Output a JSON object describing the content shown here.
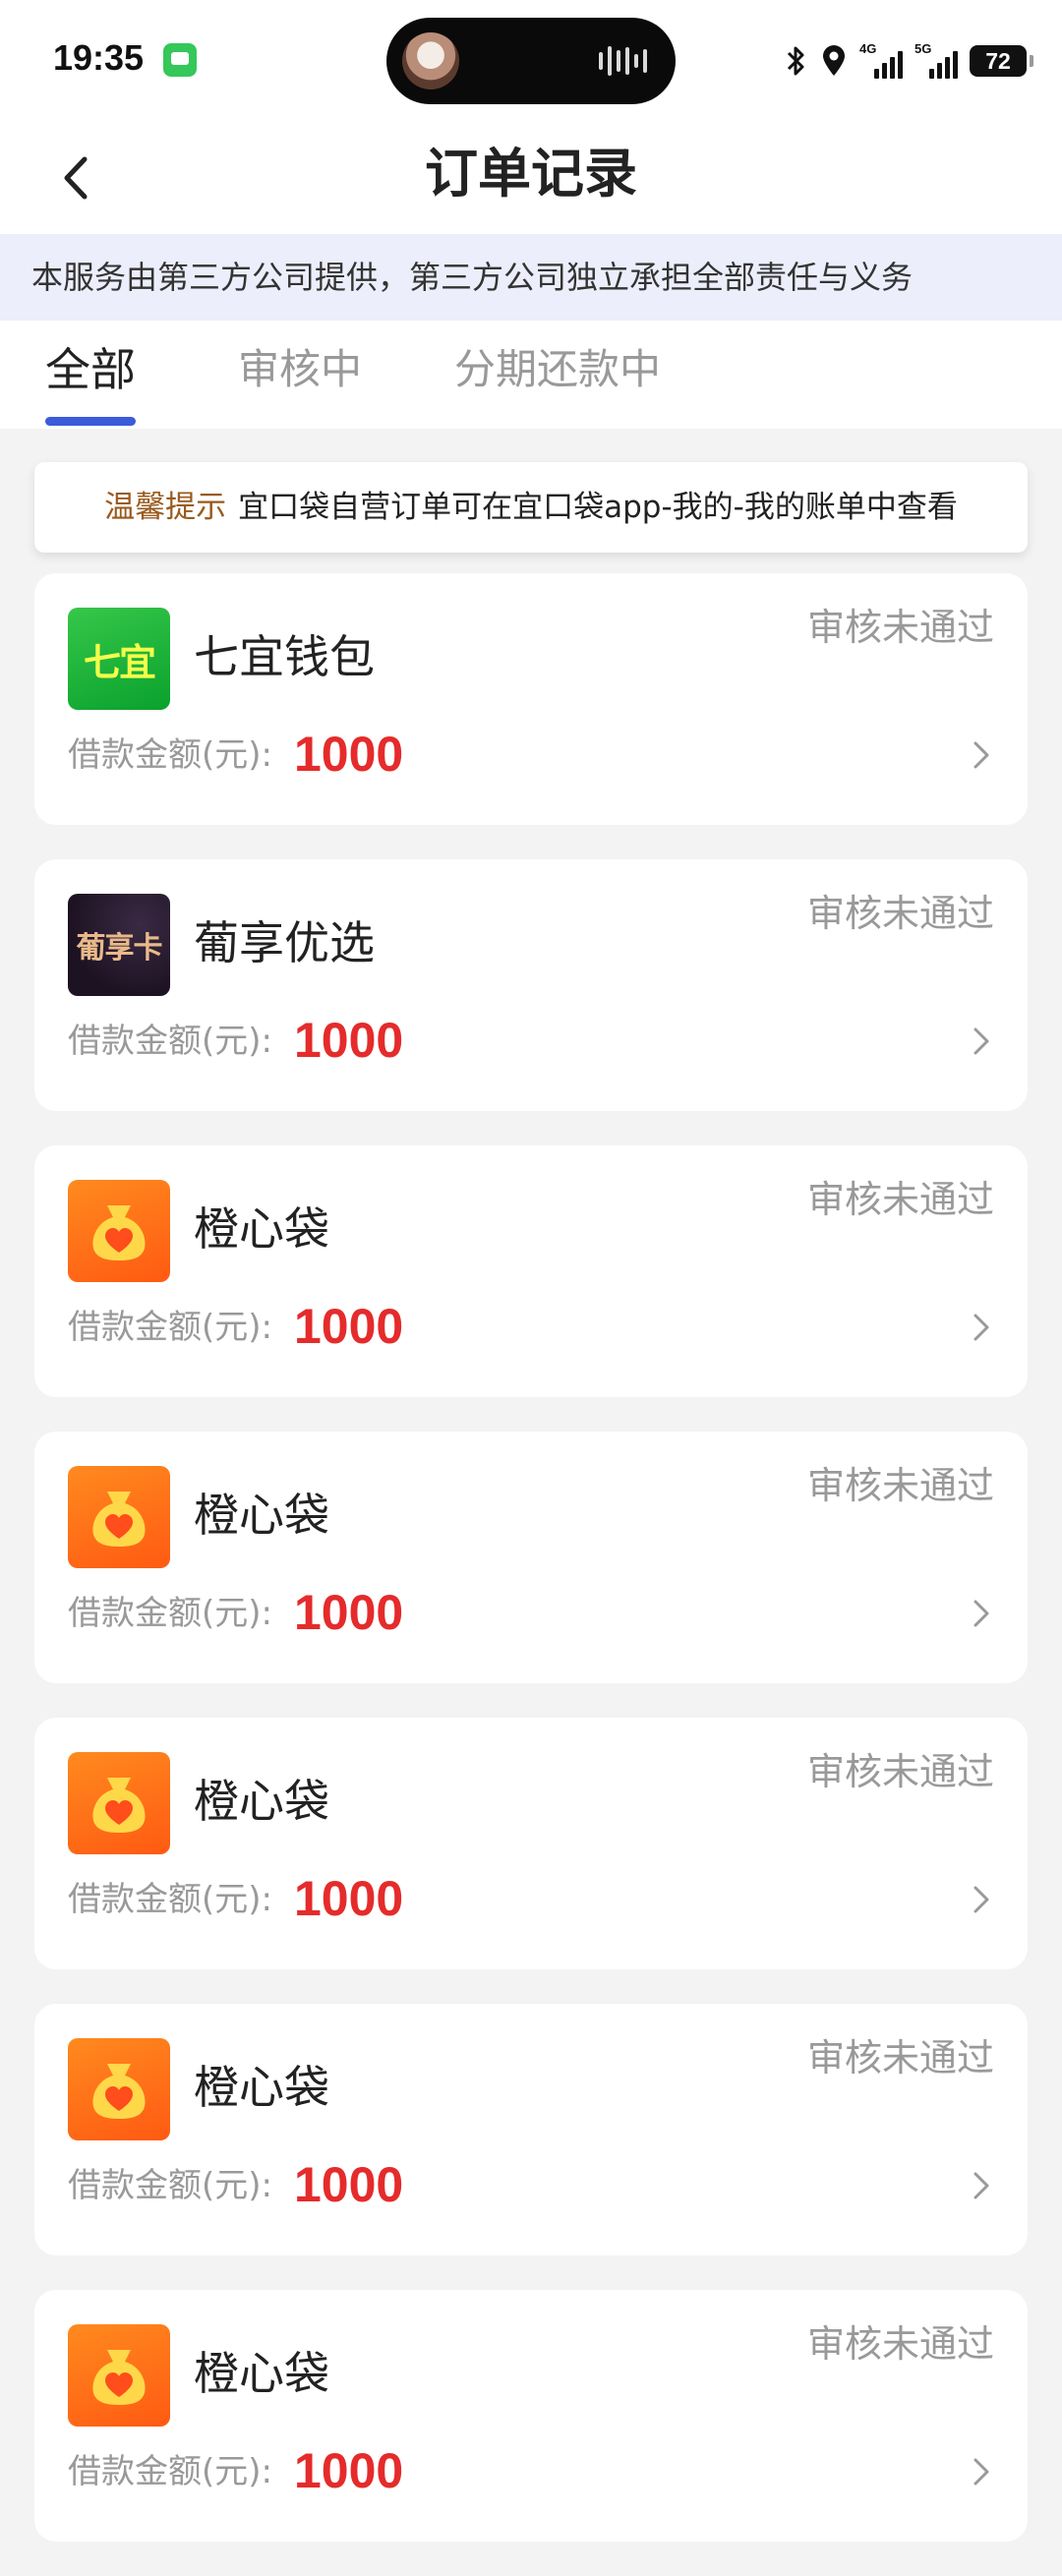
{
  "status_bar": {
    "time": "19:35",
    "network_1": "4G",
    "network_2": "5G",
    "battery": "72",
    "icons": [
      "message-icon",
      "bluetooth-icon",
      "location-icon",
      "signal-icon",
      "battery-icon"
    ]
  },
  "header": {
    "title": "订单记录",
    "back_icon": "chevron-left-icon"
  },
  "notice": {
    "text": "本服务由第三方公司提供，第三方公司独立承担全部责任与义务"
  },
  "tabs": [
    {
      "label": "全部",
      "active": true
    },
    {
      "label": "审核中",
      "active": false
    },
    {
      "label": "分期还款中",
      "active": false
    }
  ],
  "tip": {
    "label": "温馨提示",
    "text": "宜口袋自营订单可在宜口袋app-我的-我的账单中查看"
  },
  "colors": {
    "accent_blue": "#3b5bdb",
    "amount_red": "#e52b2b",
    "tip_label_brown": "#9a5a1c",
    "status_gray": "#999999"
  },
  "orders": [
    {
      "app_name": "七宜钱包",
      "logo_text": "七宜",
      "logo": "green",
      "status": "审核未通过",
      "amount_label": "借款金额(元):",
      "amount": "1000"
    },
    {
      "app_name": "葡享优选",
      "logo_text": "葡享卡",
      "logo": "dark",
      "status": "审核未通过",
      "amount_label": "借款金额(元):",
      "amount": "1000"
    },
    {
      "app_name": "橙心袋",
      "logo_text": "",
      "logo": "money-bag-heart-icon",
      "status": "审核未通过",
      "amount_label": "借款金额(元):",
      "amount": "1000"
    },
    {
      "app_name": "橙心袋",
      "logo_text": "",
      "logo": "money-bag-heart-icon",
      "status": "审核未通过",
      "amount_label": "借款金额(元):",
      "amount": "1000"
    },
    {
      "app_name": "橙心袋",
      "logo_text": "",
      "logo": "money-bag-heart-icon",
      "status": "审核未通过",
      "amount_label": "借款金额(元):",
      "amount": "1000"
    },
    {
      "app_name": "橙心袋",
      "logo_text": "",
      "logo": "money-bag-heart-icon",
      "status": "审核未通过",
      "amount_label": "借款金额(元):",
      "amount": "1000"
    },
    {
      "app_name": "橙心袋",
      "logo_text": "",
      "logo": "money-bag-heart-icon",
      "status": "审核未通过",
      "amount_label": "借款金额(元):",
      "amount": "1000"
    }
  ]
}
